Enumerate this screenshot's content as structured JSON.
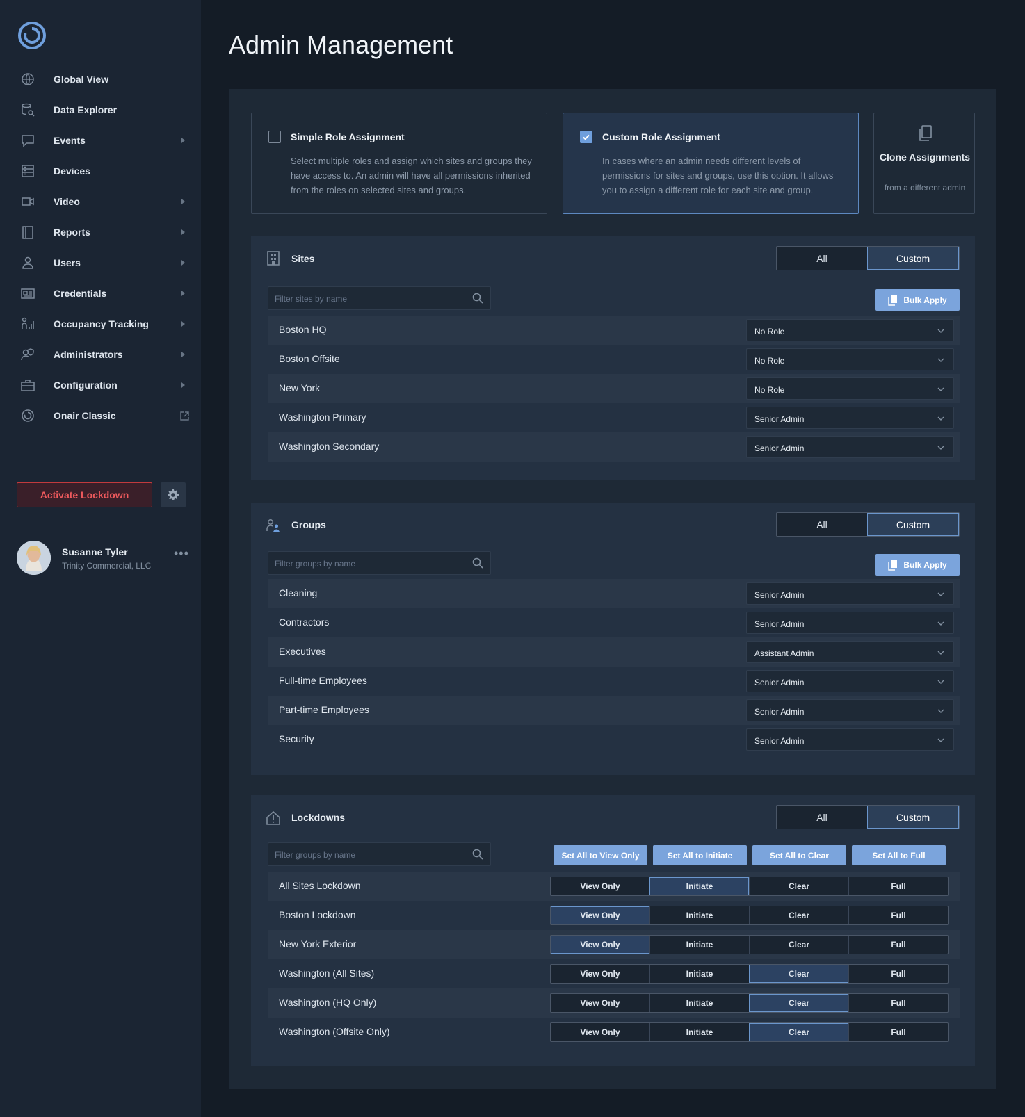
{
  "sidebar": {
    "items": [
      {
        "label": "Global View",
        "icon": "globe-icon",
        "arrow": false
      },
      {
        "label": "Data Explorer",
        "icon": "data-search-icon",
        "arrow": false
      },
      {
        "label": "Events",
        "icon": "chat-icon",
        "arrow": true
      },
      {
        "label": "Devices",
        "icon": "server-icon",
        "arrow": false
      },
      {
        "label": "Video",
        "icon": "video-camera-icon",
        "arrow": true
      },
      {
        "label": "Reports",
        "icon": "report-icon",
        "arrow": true
      },
      {
        "label": "Users",
        "icon": "user-icon",
        "arrow": true
      },
      {
        "label": "Credentials",
        "icon": "id-card-icon",
        "arrow": true
      },
      {
        "label": "Occupancy Tracking",
        "icon": "occupancy-icon",
        "arrow": true
      },
      {
        "label": "Administrators",
        "icon": "admin-icon",
        "arrow": true
      },
      {
        "label": "Configuration",
        "icon": "toolbox-icon",
        "arrow": true
      },
      {
        "label": "Onair Classic",
        "icon": "onair-logo-icon",
        "arrow": false,
        "external": true
      }
    ],
    "lockdown_label": "Activate Lockdown",
    "user": {
      "name": "Susanne Tyler",
      "org": "Trinity Commercial, LLC"
    }
  },
  "page": {
    "title": "Admin Management"
  },
  "assignment": {
    "simple": {
      "title": "Simple Role Assignment",
      "desc": "Select multiple roles and assign which sites and groups they have access to. An admin will have all permissions inherited from the roles on selected sites and groups.",
      "checked": false
    },
    "custom": {
      "title": "Custom Role Assignment",
      "desc": "In cases where an admin needs different levels of permissions for sites and groups, use this option. It allows you to assign a different role for each site and group.",
      "checked": true
    },
    "clone": {
      "title": "Clone Assignments",
      "sub": "from a different admin"
    }
  },
  "toggle": {
    "all": "All",
    "custom": "Custom"
  },
  "sites": {
    "title": "Sites",
    "search_placeholder": "Filter sites by name",
    "bulk_label": "Bulk Apply",
    "rows": [
      {
        "name": "Boston HQ",
        "role": "No Role"
      },
      {
        "name": "Boston Offsite",
        "role": "No Role"
      },
      {
        "name": "New York",
        "role": "No Role"
      },
      {
        "name": "Washington Primary",
        "role": "Senior Admin"
      },
      {
        "name": "Washington Secondary",
        "role": "Senior Admin"
      }
    ]
  },
  "groups": {
    "title": "Groups",
    "search_placeholder": "Filter groups by name",
    "bulk_label": "Bulk Apply",
    "rows": [
      {
        "name": "Cleaning",
        "role": "Senior Admin"
      },
      {
        "name": "Contractors",
        "role": "Senior Admin"
      },
      {
        "name": "Executives",
        "role": "Assistant Admin"
      },
      {
        "name": "Full-time Employees",
        "role": "Senior Admin"
      },
      {
        "name": "Part-time Employees",
        "role": "Senior Admin"
      },
      {
        "name": "Security",
        "role": "Senior Admin"
      }
    ]
  },
  "lockdowns": {
    "title": "Lockdowns",
    "search_placeholder": "Filter groups by name",
    "set_all": [
      "Set All to View Only",
      "Set All to Initiate",
      "Set All to Clear",
      "Set All to Full"
    ],
    "options": [
      "View Only",
      "Initiate",
      "Clear",
      "Full"
    ],
    "rows": [
      {
        "name": "All Sites Lockdown",
        "selected": "Initiate"
      },
      {
        "name": "Boston Lockdown",
        "selected": "View Only"
      },
      {
        "name": "New York Exterior",
        "selected": "View Only"
      },
      {
        "name": "Washington (All Sites)",
        "selected": "Clear"
      },
      {
        "name": "Washington (HQ Only)",
        "selected": "Clear"
      },
      {
        "name": "Washington (Offsite Only)",
        "selected": "Clear"
      }
    ]
  }
}
